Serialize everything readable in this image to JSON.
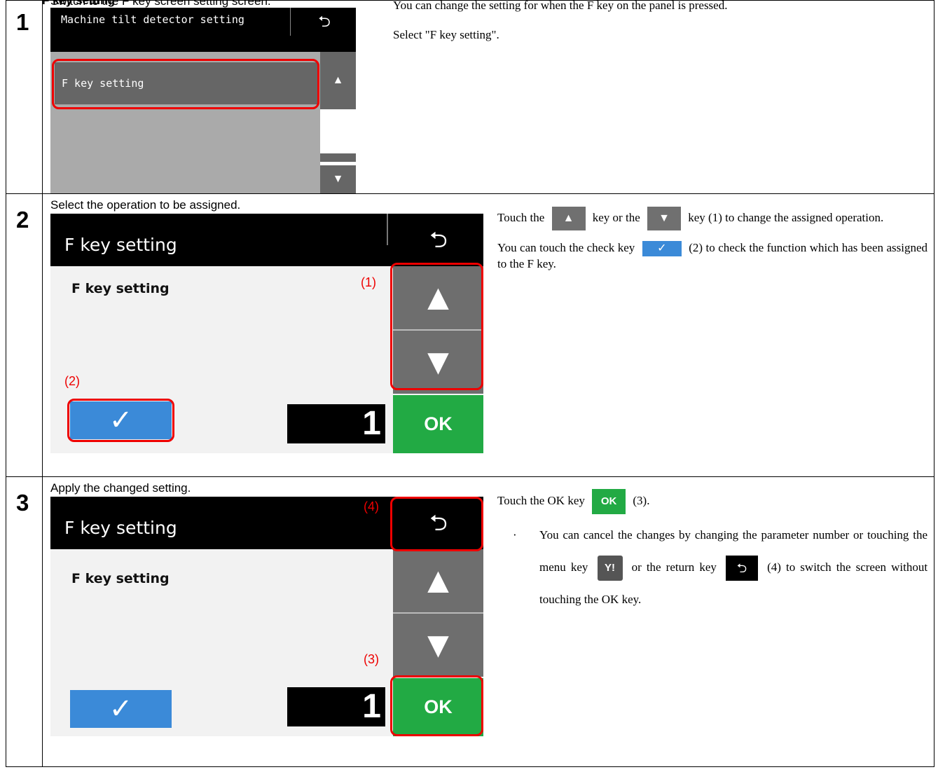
{
  "doc": {
    "cutoff_title": "F key setting"
  },
  "steps": [
    {
      "number": "1",
      "caption": "Switch to the F key screen setting screen.",
      "description": [
        "You can change the setting for when the F key on the panel is pressed.",
        "Select \"F key setting\"."
      ],
      "screen": {
        "title": "Machine tilt detector setting",
        "item": "F key setting"
      }
    },
    {
      "number": "2",
      "caption": "Select the operation to be assigned.",
      "description": {
        "p1_a": "Touch the",
        "p1_b": "key or the",
        "p1_c": "key (1) to change the assigned operation.",
        "p2_a": "You can touch the check key",
        "p2_b": "(2) to check the function which has been assigned to the F key."
      },
      "screen": {
        "title": "F key setting",
        "label": "F key setting",
        "value": "1",
        "ok_label": "OK",
        "callout_1": "(1)",
        "callout_2": "(2)"
      }
    },
    {
      "number": "3",
      "caption": "Apply the changed setting.",
      "description": {
        "p1_a": "Touch the OK key",
        "p1_b": "(3).",
        "bullet_marker": "·",
        "b_a": "You can cancel the changes by changing the parameter number or touching the menu key",
        "b_b": "or the return key",
        "b_c": "(4) to switch the screen without touching the OK key."
      },
      "screen": {
        "title": "F key setting",
        "label": "F key setting",
        "value": "1",
        "ok_label": "OK",
        "callout_3": "(3)",
        "callout_4": "(4)"
      }
    }
  ],
  "icons": {
    "up": "▲",
    "down": "▼",
    "check": "✓",
    "back": "⮌",
    "menu": "Y!"
  },
  "colors": {
    "highlight": "#ee0000",
    "ok_green": "#22aa44",
    "check_blue": "#3b8ad8"
  }
}
